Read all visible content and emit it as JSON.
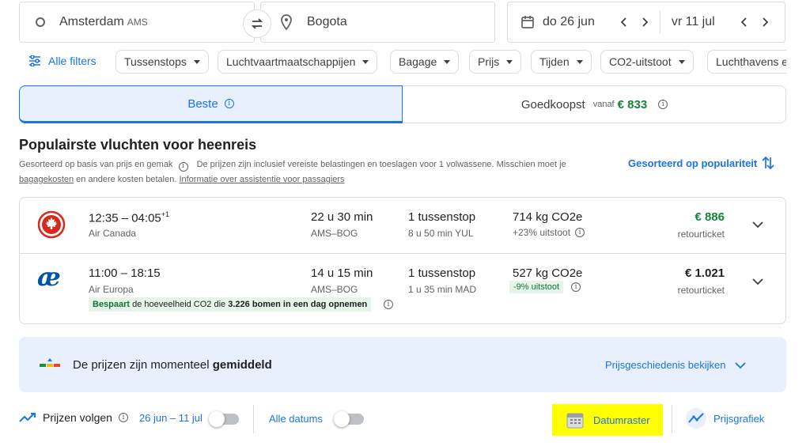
{
  "search": {
    "origin_city": "Amsterdam",
    "origin_code": "AMS",
    "destination_city": "Bogota",
    "depart_date": "do 26 jun",
    "return_date": "vr 11 jul"
  },
  "filters": {
    "all_filters": "Alle filters",
    "chips": [
      "Tussenstops",
      "Luchtvaartmaatschappijen",
      "Bagage",
      "Prijs",
      "Tijden",
      "CO2-uitstoot",
      "Luchthavens e"
    ]
  },
  "tabs": {
    "best": "Beste",
    "cheapest": "Goedkoopst",
    "cheapest_from": "vanaf",
    "cheapest_price": "€ 833"
  },
  "section": {
    "title": "Populairste vluchten voor heenreis",
    "subtitle_1": "Gesorteerd op basis van prijs en gemak",
    "subtitle_2": "De prijzen zijn inclusief vereiste belastingen en toeslagen voor 1 volwassene. Misschien moet je",
    "link_baggage": "bagagekosten",
    "subtitle_3": " en andere kosten betalen. ",
    "link_assist": "Informatie over assistentie voor passagiers",
    "sort_label": "Gesorteerd op populariteit"
  },
  "flights": [
    {
      "times": "12:35 – 04:05",
      "day_offset": "+1",
      "airline": "Air Canada",
      "duration": "22 u 30 min",
      "route": "AMS–BOG",
      "stops": "1 tussenstop",
      "layover": "8 u 50 min YUL",
      "co2": "714 kg CO2e",
      "co2_delta": "+23% uitstoot",
      "price": "€ 886",
      "price_type": "retourticket",
      "price_color": "#188038"
    },
    {
      "times": "11:00 – 18:15",
      "airline": "Air Europa",
      "duration": "14 u 15 min",
      "route": "AMS–BOG",
      "stops": "1 tussenstop",
      "layover": "1 u 35 min MAD",
      "co2": "527 kg CO2e",
      "co2_delta": "-9% uitstoot",
      "price": "€ 1.021",
      "price_type": "retourticket",
      "price_color": "#202124",
      "eco_prefix": "Bespaart",
      "eco_middle": " de hoeveelheid CO2 die ",
      "eco_count": "3.226 bomen in een dag opnemen"
    }
  ],
  "price_insight": {
    "text": "De prijzen zijn momenteel ",
    "level": "gemiddeld",
    "link": "Prijsgeschiedenis bekijken"
  },
  "bottom": {
    "track_label": "Prijzen volgen",
    "date_range": "26 jun – 11 jul",
    "all_dates": "Alle datums",
    "date_grid": "Datumraster",
    "price_graph": "Prijsgrafiek"
  },
  "colors": {
    "accent_blue": "#1a73e8",
    "green": "#188038",
    "highlight": "#ffff00"
  }
}
